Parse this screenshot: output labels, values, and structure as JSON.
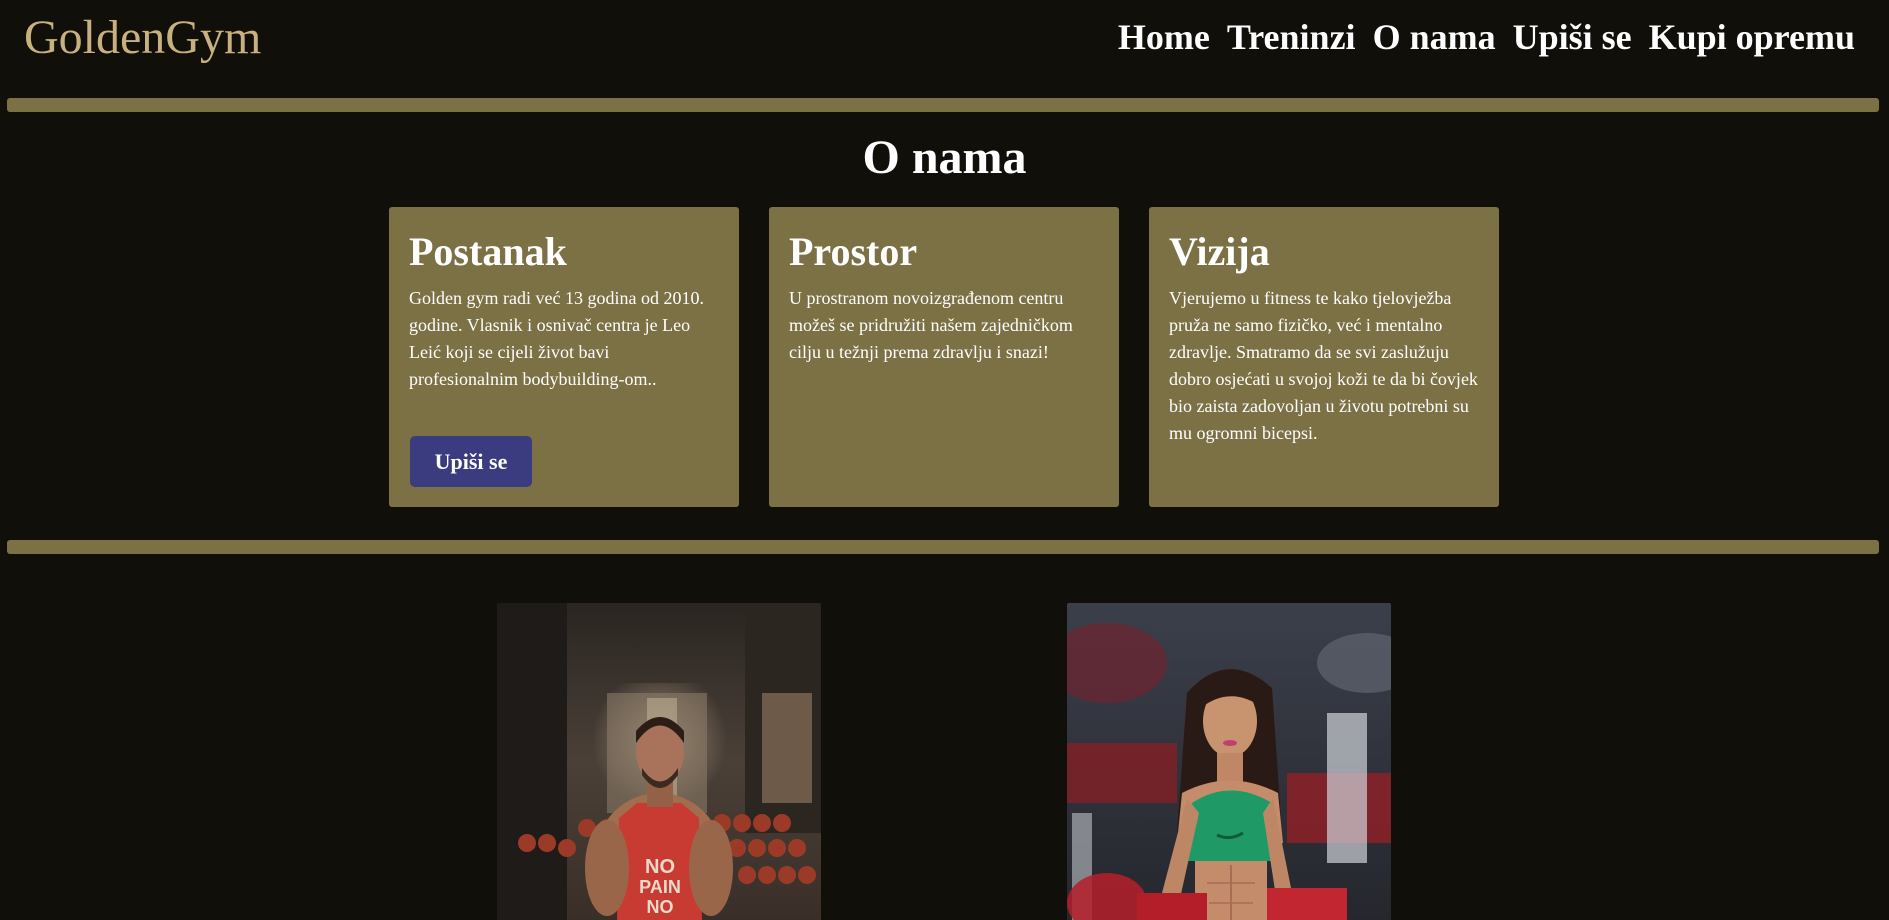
{
  "header": {
    "logo": "GoldenGym",
    "nav": [
      "Home",
      "Treninzi",
      "O nama",
      "Upiši se",
      "Kupi opremu"
    ]
  },
  "section": {
    "title": "O nama"
  },
  "cards": [
    {
      "title": "Postanak",
      "text": "Golden gym radi već 13 godina od 2010. godine. Vlasnik i osnivač centra je Leo Leić koji se cijeli život bavi profesionalnim bodybuilding-om..",
      "button": "Upiši se"
    },
    {
      "title": "Prostor",
      "text": "U prostranom novoizgrađenom centru možeš se pridružiti našem zajedničkom cilju u težnji prema zdravlju i snazi!"
    },
    {
      "title": "Vizija",
      "text": "Vjerujemo u fitness te kako tjelovježba pruža ne samo fizičko, već i mentalno zdravlje. Smatramo da se svi zaslužuju dobro osjećati u svojoj koži te da bi čovjek bio zaista zadovoljan u životu potrebni su mu ogromni bicepsi."
    }
  ],
  "photos": {
    "shirt_text": [
      "NO",
      "PAIN",
      "NO"
    ]
  },
  "colors": {
    "background": "#110f09",
    "accent": "#7c7045",
    "logo": "#c9b17f",
    "button": "#3b3c7f"
  }
}
